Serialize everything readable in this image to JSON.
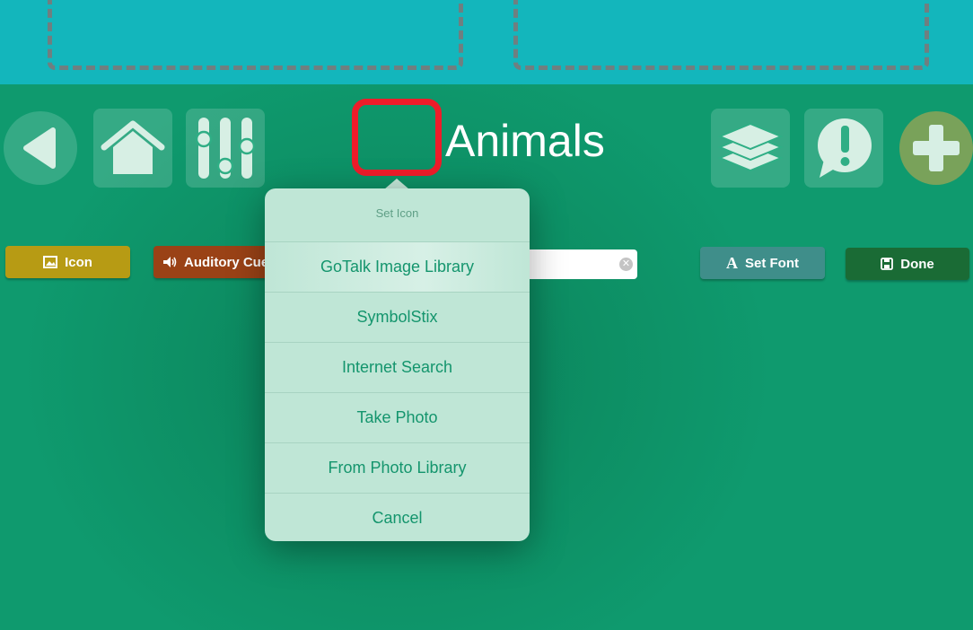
{
  "title": "Animals",
  "toolbar": {
    "icon_label": "Icon",
    "auditory_cue_label": "Auditory Cue",
    "set_font_label": "Set Font",
    "done_label": "Done"
  },
  "name_field": {
    "value": ""
  },
  "popover": {
    "title": "Set Icon",
    "items": [
      "GoTalk Image Library",
      "SymbolStix",
      "Internet Search",
      "Take Photo",
      "From Photo Library",
      "Cancel"
    ]
  },
  "colors": {
    "top_bar": "#13b6bc",
    "background": "#0f9a6e",
    "icon_button": "#b79b14",
    "auditory_button": "#9a4216",
    "set_font_button": "#3f8e8a",
    "done_button": "#1a6b35",
    "highlight": "#ee1c2a"
  },
  "icons": {
    "back": "triangle-left-icon",
    "home": "home-icon",
    "settings": "sliders-icon",
    "layers": "layers-icon",
    "alert": "speech-alert-icon",
    "add": "plus-icon"
  }
}
